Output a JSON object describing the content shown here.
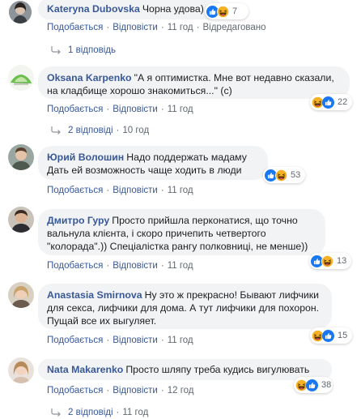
{
  "comments": [
    {
      "author": "Kateryna Dubovska",
      "text": "Чорна удова)",
      "react_count": "7",
      "like_label": "Подобається",
      "reply_label": "Відповісти",
      "time": "11 год",
      "edited": "Відредаговано",
      "replies": "1 відповідь"
    },
    {
      "author": "Oksana Karpenko",
      "text": "\"А я оптимистка. Мне вот недавно сказали, на кладбище хорошо знакомиться...\" (с)",
      "react_count": "22",
      "like_label": "Подобається",
      "reply_label": "Відповісти",
      "time": "11 год",
      "replies": "2 відповіді",
      "replies_time": "10 год"
    },
    {
      "author": "Юрий Волошин",
      "text": "Надо поддержать мадаму Дать ей возможность чаще ходить в люди",
      "react_count": "53",
      "like_label": "Подобається",
      "reply_label": "Відповісти",
      "time": "11 год"
    },
    {
      "author": "Дмитро Гуру",
      "text": "Просто прийшла перконатися, що точно вальнула клієнта, і скоро причепить четвертого \"колорада\".)) Спеціалістка рангу полковниці, не менше))",
      "react_count": "13",
      "like_label": "Подобається",
      "reply_label": "Відповісти",
      "time": "11 год"
    },
    {
      "author": "Anastasia Smirnova",
      "text": "Ну это ж прекрасно! Бывают лифчики для секса, лифчики для дома. А тут лифчики для похорон. Пущай все их выгуляет.",
      "react_count": "15",
      "like_label": "Подобається",
      "reply_label": "Відповісти",
      "time": "11 год"
    },
    {
      "author": "Nata Makarenko",
      "text": "Просто шляпу треба кудись вигулювать",
      "react_count": "38",
      "like_label": "Подобається",
      "reply_label": "Відповісти",
      "time": "12 год",
      "replies": "2 відповіді",
      "replies_time": "11 год"
    }
  ],
  "colors": {
    "link": "#385898",
    "bubble": "#f2f3f5",
    "meta": "#606770",
    "like": "#1877f2",
    "haha": "#f7b125"
  },
  "icons": {
    "like": "thumbs-up-icon",
    "haha": "laughing-emoji-icon",
    "reply": "reply-arrow-icon"
  }
}
